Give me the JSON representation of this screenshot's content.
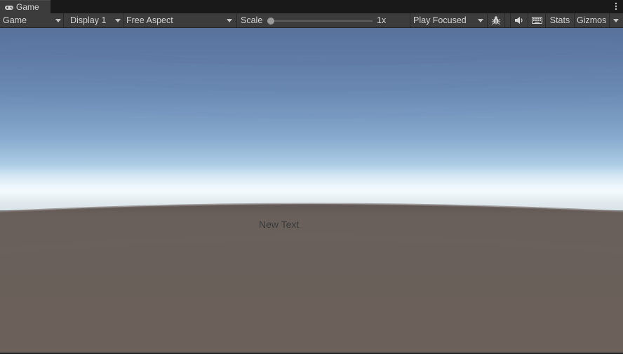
{
  "tab": {
    "title": "Game",
    "icon": "gamepad-icon"
  },
  "toolbar": {
    "mode_dropdown": "Game",
    "display_dropdown": "Display 1",
    "aspect_dropdown": "Free Aspect",
    "scale_label": "Scale",
    "scale_value": "1x",
    "play_mode_dropdown": "Play Focused",
    "stats_label": "Stats",
    "gizmos_label": "Gizmos"
  },
  "game_view": {
    "ui_text": "New Text",
    "sky_top_color": "#57719b",
    "horizon_color": "#eef6fb",
    "ground_color": "#6b605a"
  }
}
